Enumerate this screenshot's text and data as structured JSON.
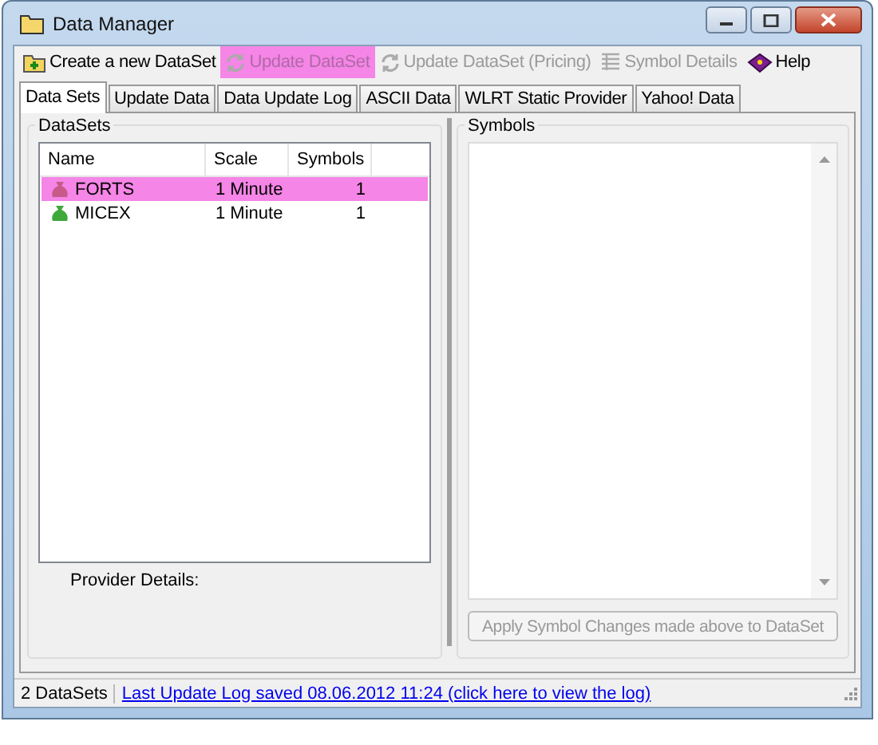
{
  "window": {
    "title": "Data Manager"
  },
  "toolbar": [
    {
      "label": "Create a new DataSet",
      "kind": "add",
      "disabled": false,
      "highlighted": false
    },
    {
      "label": "Update DataSet",
      "kind": "refresh",
      "disabled": true,
      "highlighted": true
    },
    {
      "label": "Update DataSet (Pricing)",
      "kind": "refresh",
      "disabled": true,
      "highlighted": false
    },
    {
      "label": "Symbol Details",
      "kind": "grid",
      "disabled": true,
      "highlighted": false
    },
    {
      "label": "Help",
      "kind": "help",
      "disabled": false,
      "highlighted": false
    }
  ],
  "tabs": [
    {
      "label": "Data Sets",
      "selected": true
    },
    {
      "label": "Update Data",
      "selected": false
    },
    {
      "label": "Data Update Log",
      "selected": false
    },
    {
      "label": "ASCII Data",
      "selected": false
    },
    {
      "label": "WLRT Static Provider",
      "selected": false
    },
    {
      "label": "Yahoo! Data",
      "selected": false
    }
  ],
  "datasets": {
    "title": "DataSets",
    "columns": [
      "Name",
      "Scale",
      "Symbols"
    ],
    "rows": [
      {
        "name": "FORTS",
        "scale": "1 Minute",
        "symbols": "1",
        "selected": true,
        "color": "#c85a8a"
      },
      {
        "name": "MICEX",
        "scale": "1 Minute",
        "symbols": "1",
        "selected": false,
        "color": "#3fa83a"
      }
    ],
    "provider_label": "Provider Details:"
  },
  "symbols": {
    "title": "Symbols",
    "apply_button": {
      "label": "Apply Symbol Changes made above to DataSet",
      "disabled": true
    }
  },
  "status_bar": {
    "count": "2 DataSets",
    "link": "Last Update Log saved 08.06.2012 11:24 (click here to view the log)"
  }
}
